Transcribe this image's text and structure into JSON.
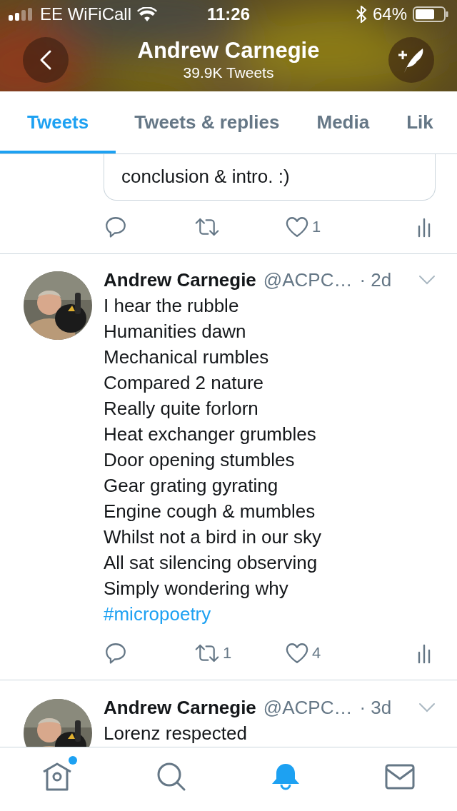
{
  "status_bar": {
    "carrier": "EE WiFiCall",
    "time": "11:26",
    "battery": "64%"
  },
  "header": {
    "title": "Andrew Carnegie",
    "subtitle": "39.9K Tweets"
  },
  "tabs": [
    {
      "label": "Tweets",
      "selected": true
    },
    {
      "label": "Tweets & replies",
      "selected": false
    },
    {
      "label": "Media",
      "selected": false
    },
    {
      "label": "Lik",
      "selected": false
    }
  ],
  "feed": [
    {
      "kind": "partial",
      "quote": "conclusion & intro. :)",
      "likes": "1"
    },
    {
      "kind": "full",
      "name": "Andrew Carnegie",
      "handle": "@ACPC…",
      "time": "· 2d",
      "lines": [
        "I hear the rubble",
        "Humanities dawn",
        "Mechanical rumbles",
        "Compared 2 nature",
        "Really quite forlorn",
        "Heat exchanger grumbles",
        "Door opening stumbles",
        "Gear grating gyrating",
        "Engine cough & mumbles",
        "Whilst not a bird in our sky",
        "All sat silencing observing",
        "Simply wondering why"
      ],
      "hashtag": "#micropoetry",
      "retweets": "1",
      "likes": "4"
    },
    {
      "kind": "cut",
      "name": "Andrew Carnegie",
      "handle": "@ACPC…",
      "time": "· 3d",
      "lines": [
        "Lorenz respected"
      ]
    }
  ],
  "nav": {
    "items": [
      {
        "kind": "home",
        "selected": false,
        "badge": true
      },
      {
        "kind": "search",
        "selected": false,
        "badge": false
      },
      {
        "kind": "notifications",
        "selected": true,
        "badge": false
      },
      {
        "kind": "messages",
        "selected": false,
        "badge": false
      }
    ]
  }
}
